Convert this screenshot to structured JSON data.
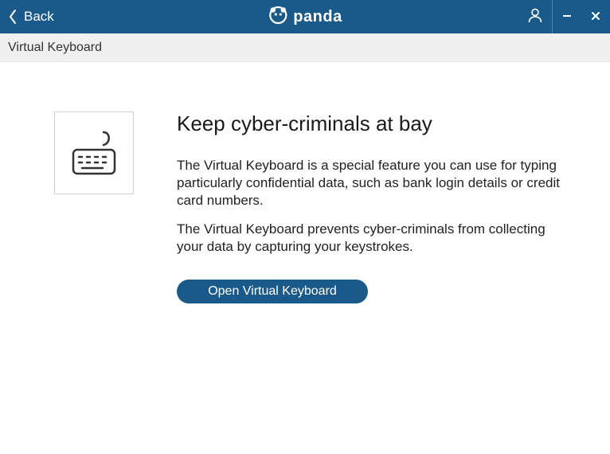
{
  "titlebar": {
    "back_label": "Back",
    "brand_name": "panda"
  },
  "subheader": {
    "title": "Virtual Keyboard"
  },
  "main": {
    "heading": "Keep cyber-criminals at bay",
    "paragraph1": "The Virtual Keyboard is a special feature you can use for typing particularly confidential data, such as bank login details or credit card numbers.",
    "paragraph2": "The Virtual Keyboard prevents cyber-criminals from collecting your data by capturing your keystrokes.",
    "button_label": "Open Virtual Keyboard"
  },
  "colors": {
    "primary": "#1a5a8a"
  }
}
